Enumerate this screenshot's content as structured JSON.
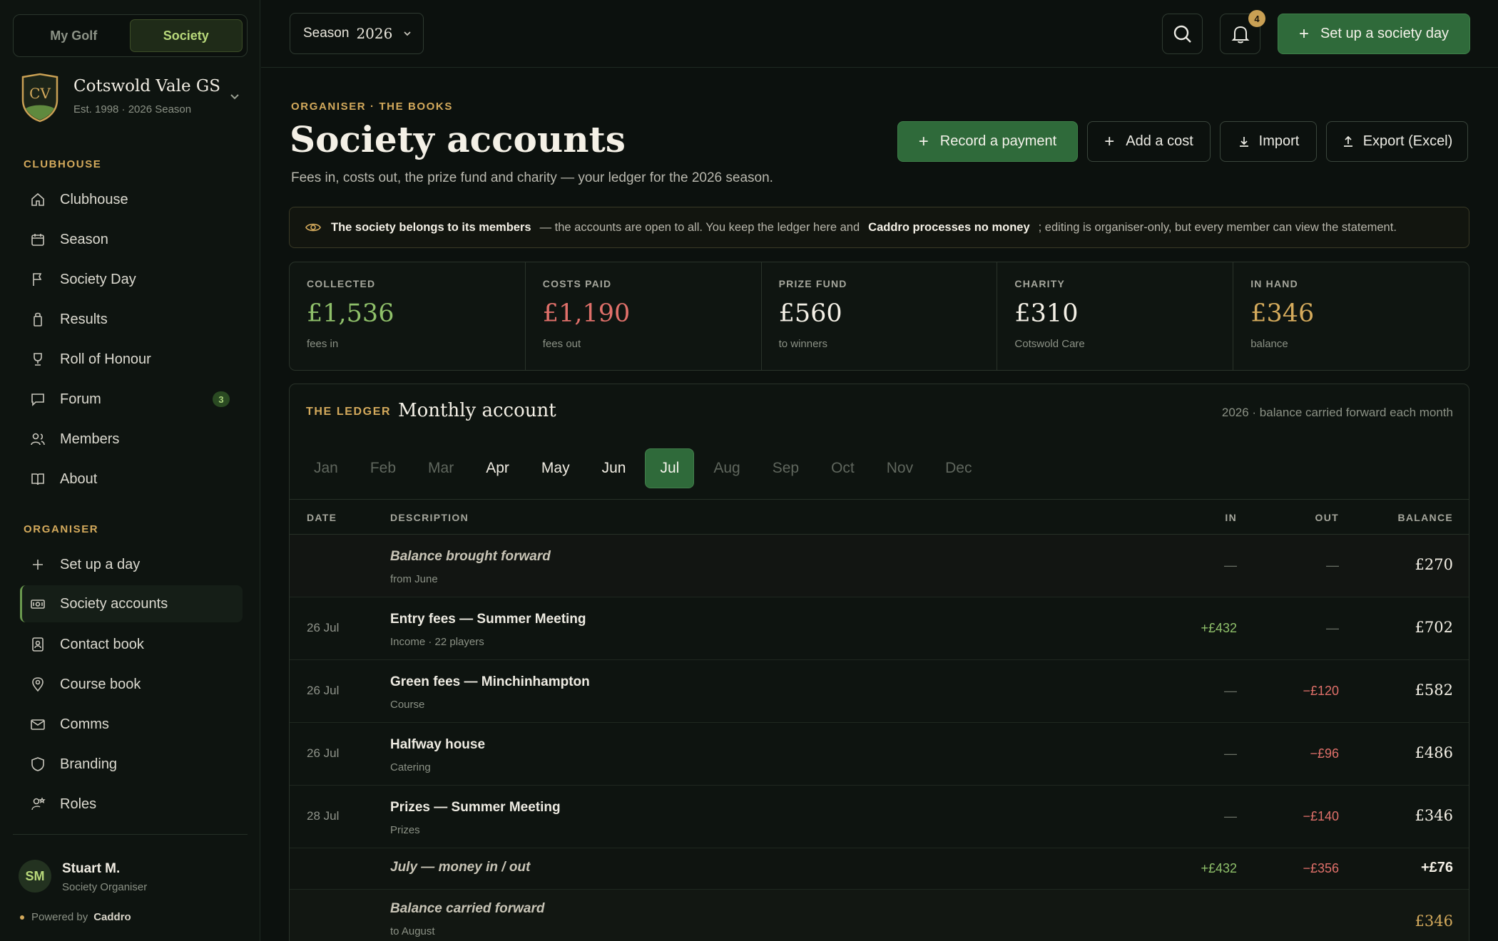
{
  "app": {
    "toggle": [
      "My Golf",
      "Society"
    ],
    "club": {
      "initials": "CV",
      "name": "Cotswold Vale GS",
      "sub": "Est. 1998 · 2026 Season"
    },
    "sections": {
      "clubhouse": "CLUBHOUSE",
      "organiser": "ORGANISER"
    },
    "clubhouse_items": [
      {
        "label": "Clubhouse",
        "icon": "home-icon"
      },
      {
        "label": "Season",
        "icon": "calendar-icon"
      },
      {
        "label": "Society Day",
        "icon": "flag-icon"
      },
      {
        "label": "Results",
        "icon": "scorecard-icon"
      },
      {
        "label": "Roll of Honour",
        "icon": "trophy-icon"
      },
      {
        "label": "Forum",
        "icon": "chat-icon",
        "badge": "3"
      },
      {
        "label": "Members",
        "icon": "users-icon"
      },
      {
        "label": "About",
        "icon": "book-icon"
      }
    ],
    "organiser_items": [
      {
        "label": "Set up a day",
        "icon": "plus-icon"
      },
      {
        "label": "Society accounts",
        "icon": "banknote-icon",
        "active": true
      },
      {
        "label": "Contact book",
        "icon": "contact-icon"
      },
      {
        "label": "Course book",
        "icon": "pin-icon"
      },
      {
        "label": "Comms",
        "icon": "mail-icon"
      },
      {
        "label": "Branding",
        "icon": "shield-icon"
      },
      {
        "label": "Roles",
        "icon": "user-star-icon"
      }
    ],
    "user": {
      "initials": "SM",
      "name": "Stuart M.",
      "role": "Society Organiser"
    },
    "powered": {
      "prefix": "Powered by",
      "brand": "Caddro"
    }
  },
  "topbar": {
    "season_label": "Season",
    "season_year": "2026",
    "notif_count": "4",
    "setup_label": "Set up a society day"
  },
  "header": {
    "eyebrow": "ORGANISER · THE BOOKS",
    "title": "Society accounts",
    "subtitle": "Fees in, costs out, the prize fund and charity — your ledger for the 2026 season.",
    "actions": {
      "record": "Record a payment",
      "add_cost": "Add a cost",
      "import": "Import",
      "export": "Export (Excel)"
    }
  },
  "notice": {
    "strong1": "The society belongs to its members",
    "text1": "— the accounts are open to all. You keep the ledger here and",
    "strong2": "Caddro processes no money",
    "text2": "; editing is organiser-only, but every member can view the statement."
  },
  "stats": [
    {
      "label": "COLLECTED",
      "value": "£1,536",
      "sub": "fees in",
      "color": "#8fc06a"
    },
    {
      "label": "COSTS PAID",
      "value": "£1,190",
      "sub": "fees out",
      "color": "#e0706a"
    },
    {
      "label": "PRIZE FUND",
      "value": "£560",
      "sub": "to winners",
      "color": "#f4f0e6"
    },
    {
      "label": "CHARITY",
      "value": "£310",
      "sub": "Cotswold Care",
      "color": "#f4f0e6"
    },
    {
      "label": "IN HAND",
      "value": "£346",
      "sub": "balance",
      "color": "#d4aa5c"
    }
  ],
  "ledger": {
    "eyebrow": "THE LEDGER",
    "title": "Monthly account",
    "note": "2026 · balance carried forward each month",
    "months": [
      "Jan",
      "Feb",
      "Mar",
      "Apr",
      "May",
      "Jun",
      "Jul",
      "Aug",
      "Sep",
      "Oct",
      "Nov",
      "Dec"
    ],
    "active_month": "Jul",
    "months_with_data": [
      "Apr",
      "May",
      "Jun",
      "Jul"
    ],
    "columns": {
      "date": "DATE",
      "desc": "DESCRIPTION",
      "in": "IN",
      "out": "OUT",
      "balance": "BALANCE"
    },
    "rows": [
      {
        "kind": "bf",
        "date": "",
        "title": "Balance brought forward",
        "sub": "from June",
        "in": "—",
        "out": "—",
        "balance": "£270"
      },
      {
        "kind": "entry",
        "date": "26 Jul",
        "title": "Entry fees — Summer Meeting",
        "sub": "Income · 22 players",
        "in": "+£432",
        "out": "—",
        "balance": "£702"
      },
      {
        "kind": "entry",
        "date": "26 Jul",
        "title": "Green fees — Minchinhampton",
        "sub": "Course",
        "in": "—",
        "out": "−£120",
        "balance": "£582"
      },
      {
        "kind": "entry",
        "date": "26 Jul",
        "title": "Halfway house",
        "sub": "Catering",
        "in": "—",
        "out": "−£96",
        "balance": "£486"
      },
      {
        "kind": "entry",
        "date": "28 Jul",
        "title": "Prizes — Summer Meeting",
        "sub": "Prizes",
        "in": "—",
        "out": "−£140",
        "balance": "£346"
      }
    ],
    "summary": {
      "title": "July — money in / out",
      "in": "+£432",
      "out": "−£356",
      "balance": "+£76"
    },
    "carried": {
      "title": "Balance carried forward",
      "sub": "to August",
      "balance": "£346"
    }
  }
}
